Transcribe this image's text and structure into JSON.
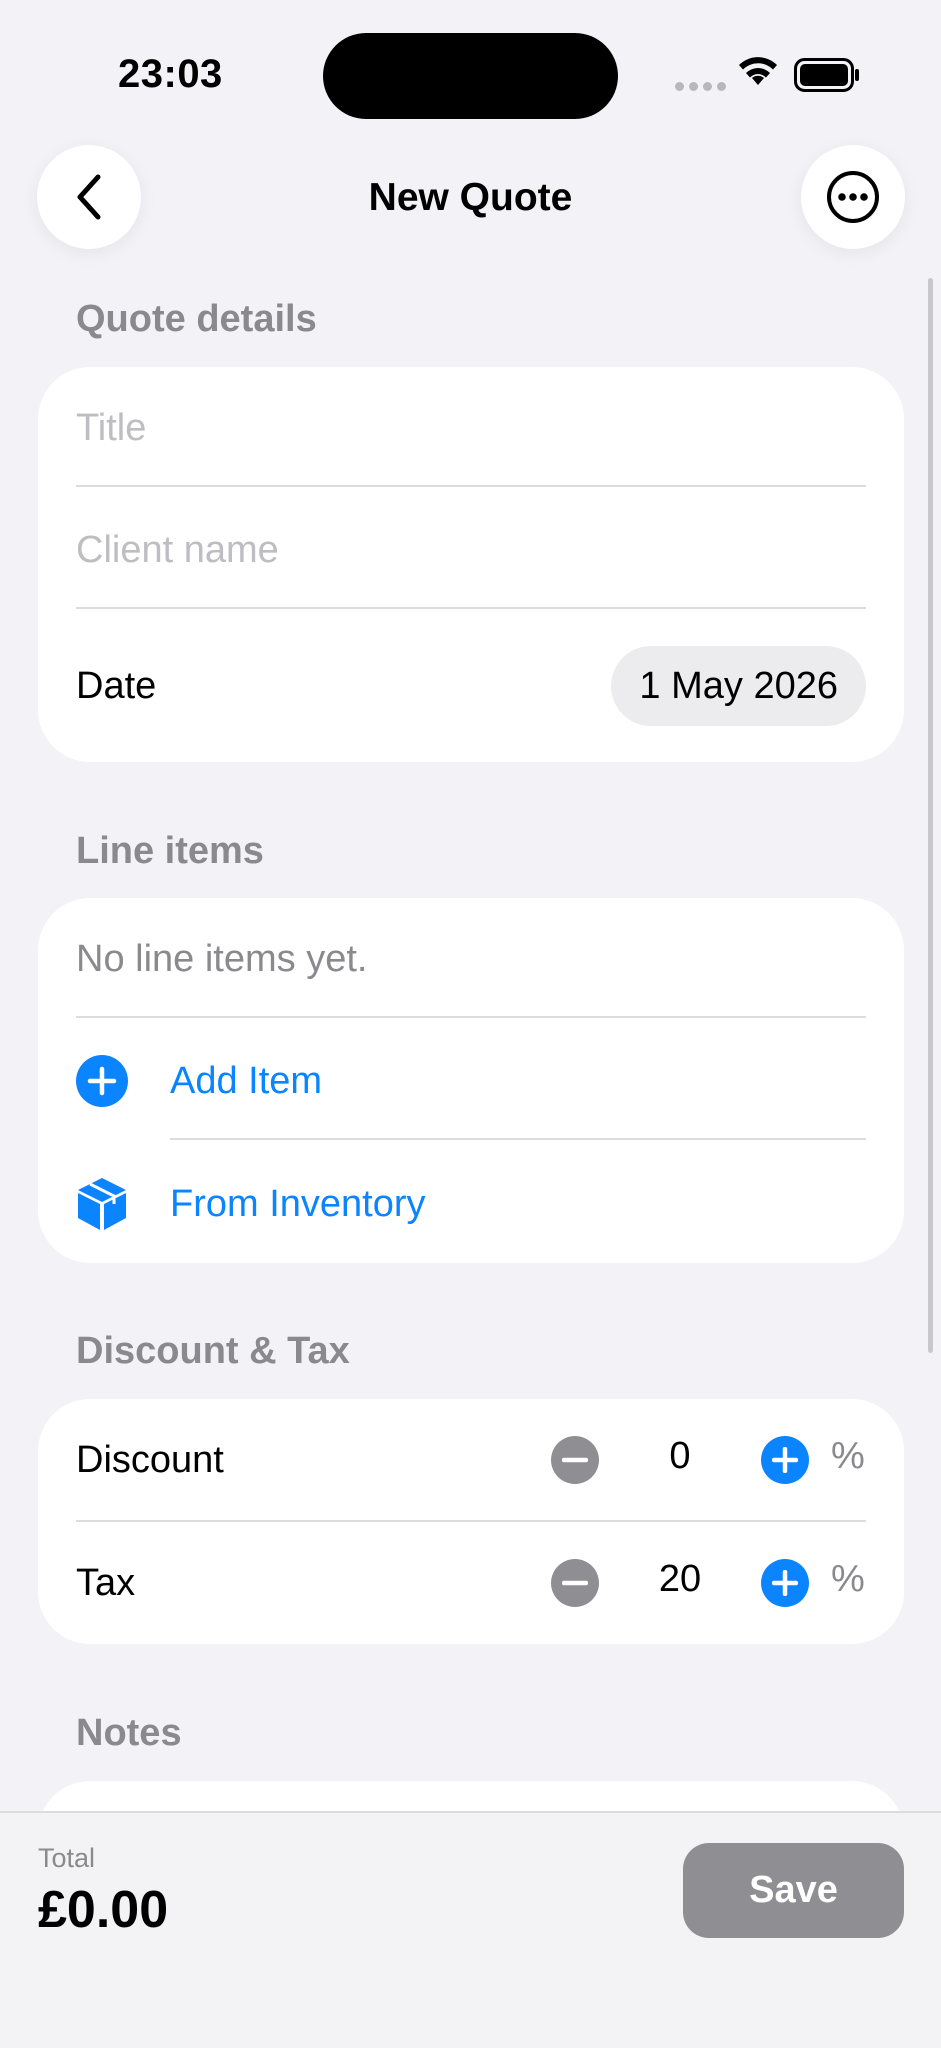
{
  "status_bar": {
    "time": "23:03"
  },
  "nav": {
    "title": "New Quote"
  },
  "quote_details": {
    "header": "Quote details",
    "title_placeholder": "Title",
    "client_placeholder": "Client name",
    "date_label": "Date",
    "date_value": "1 May 2026"
  },
  "line_items": {
    "header": "Line items",
    "empty_text": "No line items yet.",
    "add_item_label": "Add Item",
    "from_inventory_label": "From Inventory"
  },
  "discount_tax": {
    "header": "Discount & Tax",
    "discount_label": "Discount",
    "discount_value": "0",
    "tax_label": "Tax",
    "tax_value": "20",
    "percent_symbol": "%"
  },
  "notes": {
    "header": "Notes"
  },
  "footer": {
    "total_label": "Total",
    "total_value": "£0.00",
    "save_label": "Save"
  },
  "colors": {
    "accent": "#0a84ff",
    "disabled": "#8e8e93",
    "background": "#f2f2f7"
  }
}
